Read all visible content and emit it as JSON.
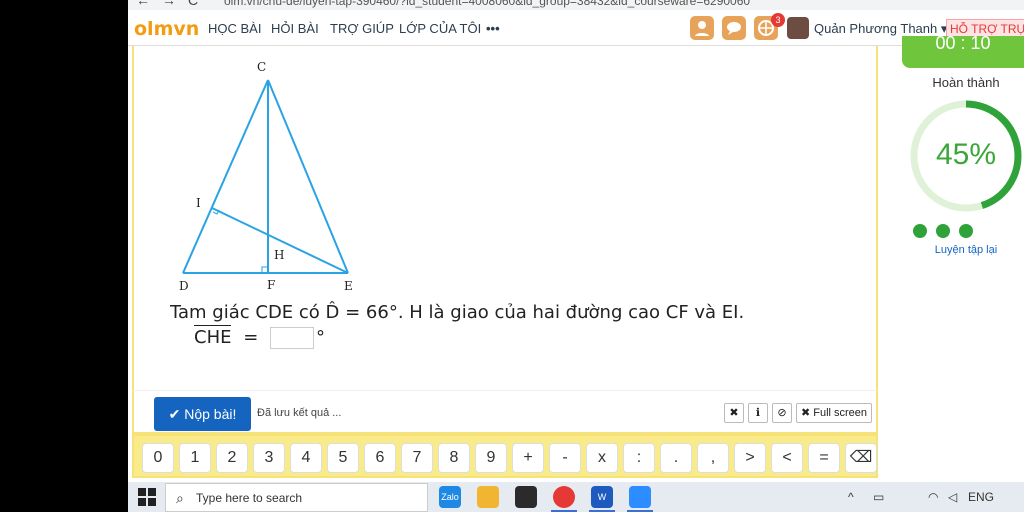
{
  "browser": {
    "url": "olm.vn/chu-de/luyen-tap-390460/?id_student=4008060&id_group=38432&id_courseware=6290060",
    "back": "←",
    "forward": "→",
    "reload": "C"
  },
  "header": {
    "logo_main": "olm",
    "logo_dot": ".",
    "logo_tld": "vn",
    "menu": [
      "HỌC BÀI",
      "HỎI BÀI",
      "TRỢ GIÚP",
      "LỚP CỦA TÔI",
      "•••"
    ],
    "notification_count": "3",
    "user_name": "Quản Phương Thanh ▾",
    "support_label": "HỖ TRỢ TRỰC"
  },
  "figure": {
    "labels": {
      "C": "C",
      "I": "I",
      "H": "H",
      "D": "D",
      "F": "F",
      "E": "E"
    },
    "line_color": "#29a3e3"
  },
  "question": {
    "text": "Tam giác CDE có D̂ = 66°. H là giao của hai đường cao CF và EI.",
    "answer_label": "CHE",
    "answer_eq": "=",
    "answer_value": "",
    "answer_unit": "°"
  },
  "actions": {
    "submit_label": "✔ Nộp bài!",
    "saved_status": "Đã lưu kết quả ...",
    "tools": [
      "✖",
      "ℹ",
      "⊘",
      "✖ Full screen"
    ]
  },
  "keypad": {
    "keys": [
      "0",
      "1",
      "2",
      "3",
      "4",
      "5",
      "6",
      "7",
      "8",
      "9",
      "+",
      "-",
      "x",
      ":",
      ".",
      ",",
      ">",
      "<",
      "=",
      "⌫"
    ]
  },
  "sidebar": {
    "timer": "00 : 10",
    "complete_label": "Hoàn thành",
    "progress_percent": 45,
    "progress_text": "45%",
    "retry_label": "Luyện tập lại",
    "accent_color": "#2fa33a"
  },
  "taskbar": {
    "search_placeholder": "Type here to search",
    "apps": [
      "Zalo",
      "Files",
      "Store",
      "Chrome",
      "Word",
      "Zoom"
    ],
    "tray_text": "ENG"
  }
}
